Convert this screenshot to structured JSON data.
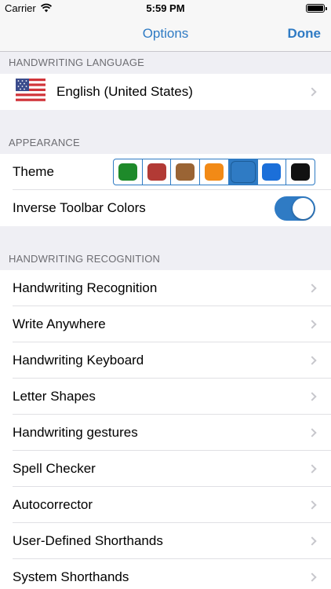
{
  "status": {
    "carrier": "Carrier",
    "time": "5:59 PM"
  },
  "nav": {
    "title": "Options",
    "done_label": "Done"
  },
  "sections": {
    "language": {
      "header": "HANDWRITING LANGUAGE",
      "language_label": "English (United States)",
      "flag_icon": "us-flag-icon"
    },
    "appearance": {
      "header": "APPEARANCE",
      "theme_label": "Theme",
      "theme_colors": [
        "#1e8a2a",
        "#b23a35",
        "#9a6434",
        "#f28a16",
        "#2f7bc4",
        "#1b6fd9",
        "#111111"
      ],
      "selected_theme_index": 4,
      "inverse_toolbar_label": "Inverse Toolbar Colors",
      "inverse_toolbar_on": true
    },
    "recognition": {
      "header": "HANDWRITING RECOGNITION",
      "items": [
        "Handwriting Recognition",
        "Write Anywhere",
        "Handwriting Keyboard",
        "Letter Shapes",
        "Handwriting gestures",
        "Spell Checker",
        "Autocorrector",
        "User-Defined Shorthands",
        "System Shorthands"
      ]
    }
  },
  "colors": {
    "accent": "#2f7bc4",
    "background": "#efeff4"
  }
}
